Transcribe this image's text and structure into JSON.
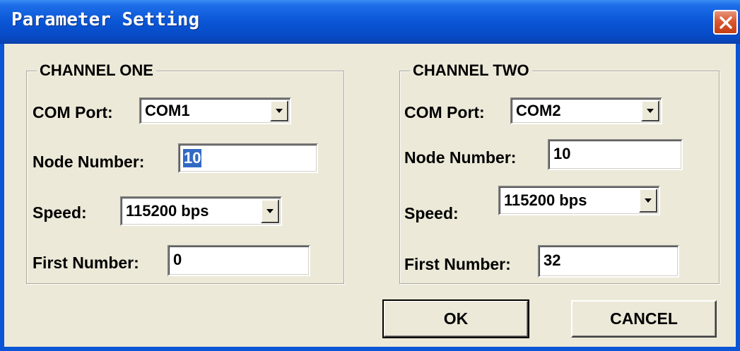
{
  "window": {
    "title": "Parameter Setting"
  },
  "channel_one": {
    "legend": "CHANNEL ONE",
    "com_port": {
      "label": "COM Port:",
      "value": "COM1"
    },
    "node_number": {
      "label": "Node Number:",
      "value": "10"
    },
    "speed": {
      "label": "Speed:",
      "value": "115200 bps"
    },
    "first_number": {
      "label": "First Number:",
      "value": "0"
    }
  },
  "channel_two": {
    "legend": "CHANNEL TWO",
    "com_port": {
      "label": "COM Port:",
      "value": "COM2"
    },
    "node_number": {
      "label": "Node Number:",
      "value": "10"
    },
    "speed": {
      "label": "Speed:",
      "value": "115200 bps"
    },
    "first_number": {
      "label": "First Number:",
      "value": "32"
    }
  },
  "buttons": {
    "ok": "OK",
    "cancel": "CANCEL"
  },
  "icons": {
    "close": "close-icon",
    "dropdown": "chevron-down-icon"
  },
  "colors": {
    "titlebar": "#0a56d6",
    "selection": "#316ac5",
    "close": "#d9582f",
    "dialog_bg": "#ece9d8"
  }
}
